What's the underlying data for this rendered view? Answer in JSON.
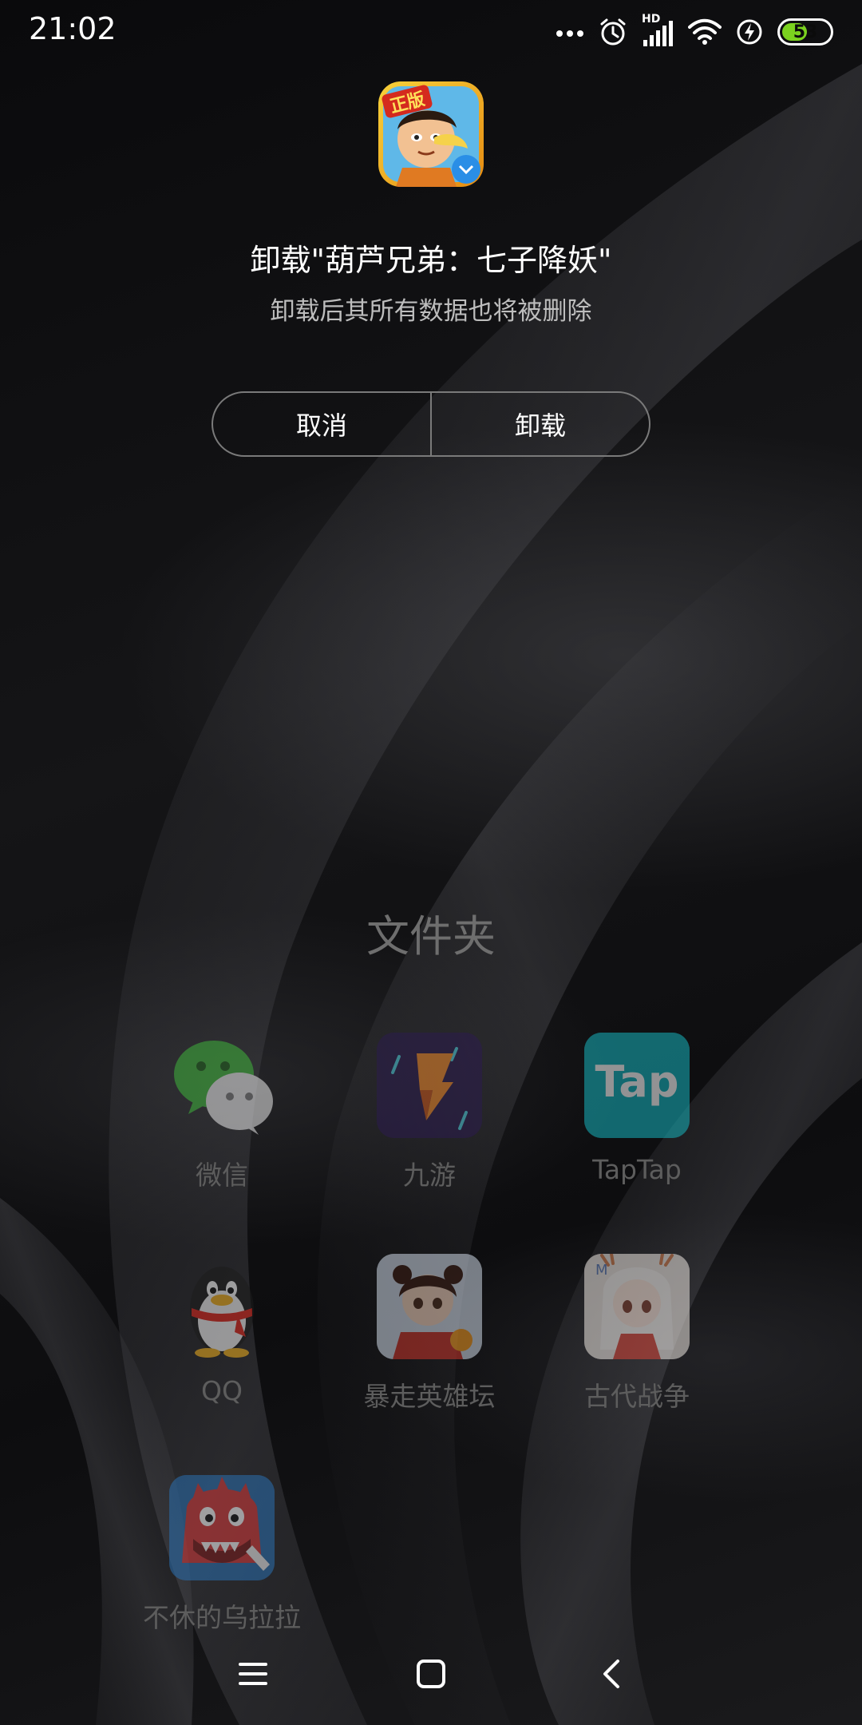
{
  "status_bar": {
    "time": "21:02",
    "signal_label": "HD",
    "battery_level": "53",
    "battery_fraction": 0.53,
    "icons": [
      "more-dots-icon",
      "alarm-icon",
      "cell-signal-icon",
      "wifi-icon",
      "charging-icon",
      "battery-icon"
    ]
  },
  "dialog": {
    "app_icon_badge": "正版",
    "title": "卸载\"葫芦兄弟：七子降妖\"",
    "subtitle": "卸载后其所有数据也将被删除",
    "cancel_label": "取消",
    "uninstall_label": "卸载"
  },
  "folder": {
    "title": "文件夹",
    "apps": [
      {
        "label": "微信",
        "icon": "wechat-icon"
      },
      {
        "label": "九游",
        "icon": "jiuyou-icon"
      },
      {
        "label": "TapTap",
        "icon": "taptap-icon",
        "icon_text": "Tap"
      },
      {
        "label": "QQ",
        "icon": "qq-penguin-icon"
      },
      {
        "label": "暴走英雄坛",
        "icon": "baozou-game-icon"
      },
      {
        "label": "古代战争",
        "icon": "ancient-war-game-icon"
      },
      {
        "label": "不休的乌拉拉",
        "icon": "wulala-game-icon"
      }
    ]
  },
  "nav_bar": {
    "icons": [
      "menu-icon",
      "home-icon",
      "back-icon"
    ]
  },
  "colors": {
    "battery_green": "#7bd21f",
    "wechat_green": "#3fb43b",
    "taptap_teal": "#17b3bd",
    "jiuyou_orange": "#f28a2a"
  }
}
